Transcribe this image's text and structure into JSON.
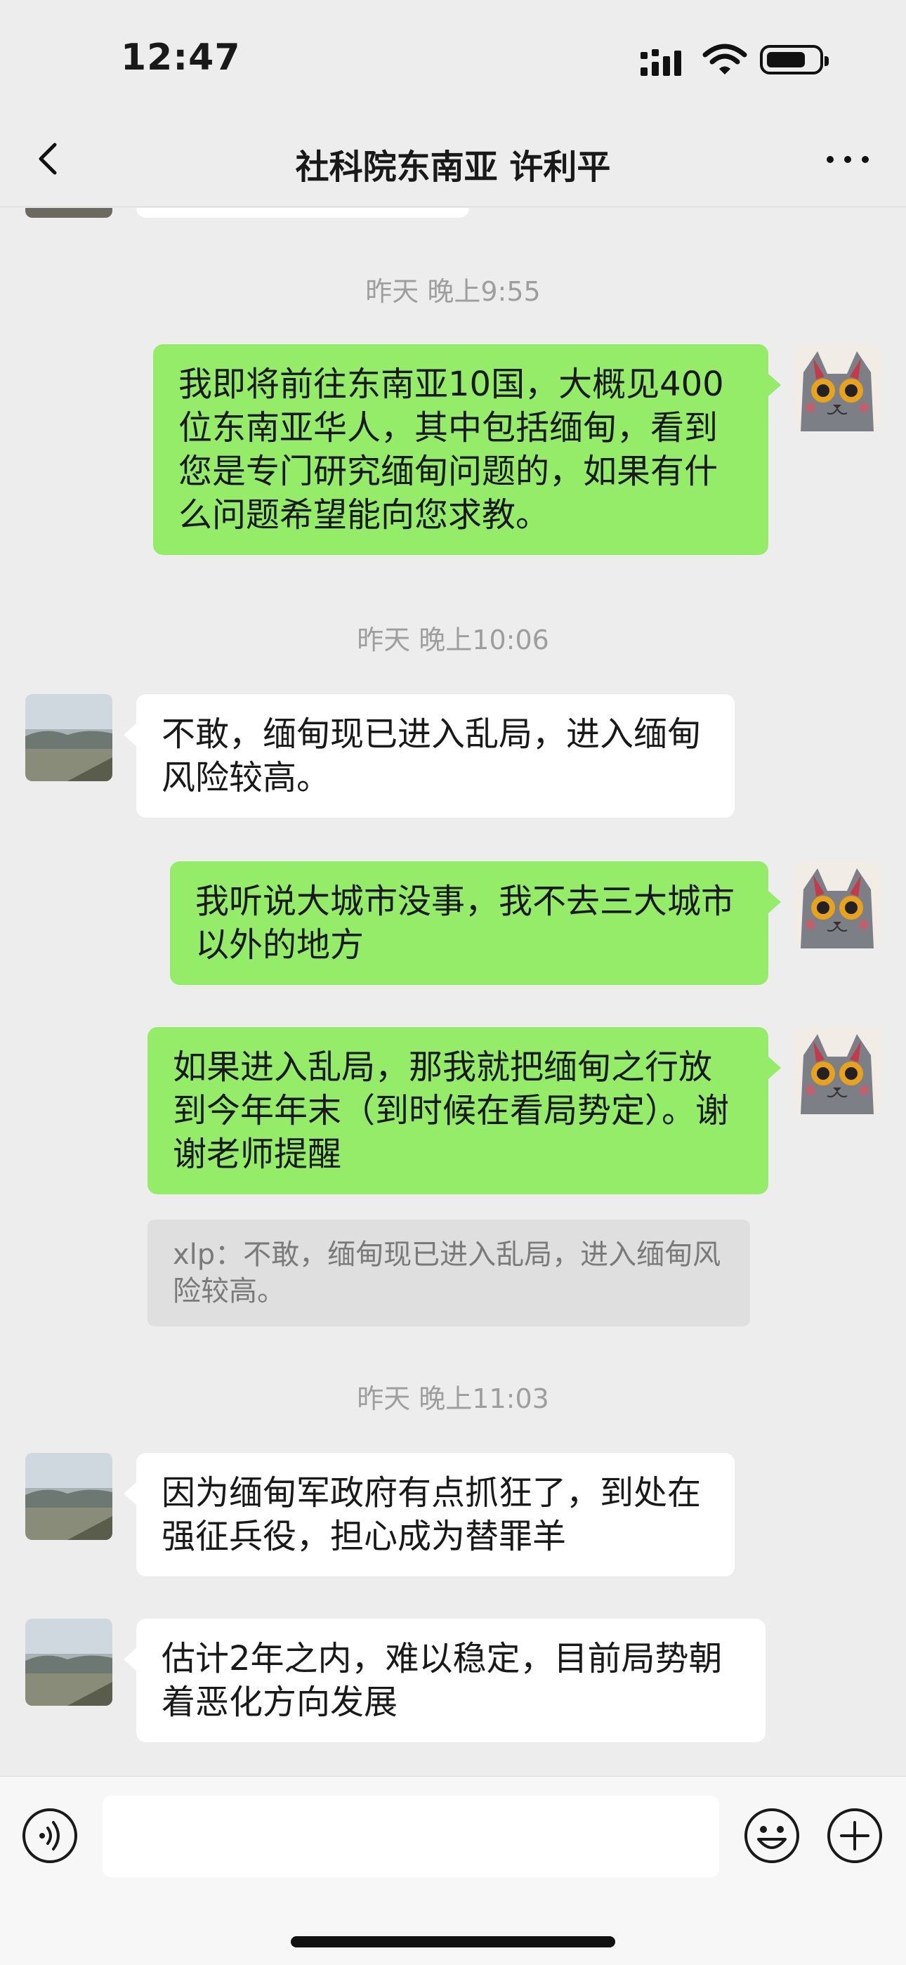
{
  "status_bar": {
    "time": "12:47"
  },
  "header": {
    "title": "社科院东南亚 许利平"
  },
  "messages": {
    "ts1": "昨天 晚上9:55",
    "m1": "我即将前往东南亚10国，大概见400位东南亚华人，其中包括缅甸，看到您是专门研究缅甸问题的，如果有什么问题希望能向您求教。",
    "ts2": "昨天 晚上10:06",
    "m2": "不敢，缅甸现已进入乱局，进入缅甸风险较高。",
    "m3": "我听说大城市没事，我不去三大城市以外的地方",
    "m4": "如果进入乱局，那我就把缅甸之行放到今年年末（到时候在看局势定）。谢谢老师提醒",
    "q4": "xlp：不敢，缅甸现已进入乱局，进入缅甸风险较高。",
    "ts3": "昨天 晚上11:03",
    "m5": "因为缅甸军政府有点抓狂了，到处在强征兵役，担心成为替罪羊",
    "m6": "估计2年之内，难以稳定，目前局势朝着恶化方向发展"
  },
  "icons": {
    "back": "chevron-left-icon",
    "more": "more-dots-icon",
    "voice": "voice-icon",
    "emoji": "emoji-icon",
    "plus": "plus-icon"
  },
  "colors": {
    "bubble_self": "#95ec69",
    "bubble_other": "#ffffff",
    "background": "#ededed"
  }
}
